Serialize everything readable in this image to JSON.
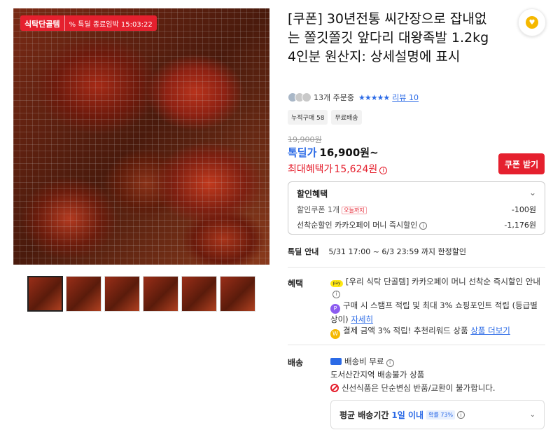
{
  "product": {
    "badge_label": "식탁단골템",
    "deal_badge": "% 특딜 종료임박 15:03:22",
    "title": "[쿠폰] 30년전통 씨간장으로 잡내없는 쫄깃쫄깃 앞다리 대왕족발 1.2kg 4인분 원산지: 상세설명에 표시",
    "buyer_count": "13개 주문중",
    "stars": "★★★★★",
    "review_link": "리뷰 10",
    "chips": [
      "누적구매 58",
      "무료배송"
    ],
    "original_price": "19,900원",
    "deal_label": "톡딜가",
    "deal_price": "16,900원~",
    "max_benefit_label": "최대혜택가",
    "max_benefit_price": "15,624원",
    "coupon_button": "쿠폰 받기"
  },
  "discount": {
    "header": "할인혜택",
    "rows": [
      {
        "label": "할인쿠폰 1개",
        "tag": "오늘까지",
        "value": "-100원"
      },
      {
        "label": "선착순할인 카카오페이 머니 즉시할인",
        "value": "-1,176원"
      }
    ]
  },
  "notice": {
    "label": "톡딜 안내",
    "text": "5/31 17:00 ~ 6/3 23:59 까지 한정할인"
  },
  "benefits": {
    "label": "혜택",
    "items": [
      "[우리 식탁 단골템] 카카오페이 머니 선착순 즉시할인 안내",
      "구매 시 스탬프 적립 및 최대 3% 쇼핑포인트 적립 (등급별 상이)",
      "자세히",
      "결제 금액 3% 적립! 추천리워드 상품",
      "상품 더보기"
    ]
  },
  "shipping": {
    "label": "배송",
    "fee": "배송비 무료",
    "region": "도서산간지역 배송불가 상품",
    "warning": "신선식품은 단순변심 반품/교환이 불가합니다.",
    "avg_label": "평균 배송기간",
    "avg_value": "1일 이내",
    "probability": "확률 73%"
  },
  "icons": [
    "heart-coin-icon",
    "star-icon",
    "kakaopay-icon",
    "point-icon",
    "coin-icon",
    "truck-icon",
    "ban-icon",
    "chevron-down-icon",
    "info-icon"
  ],
  "colors": {
    "accent_red": "#e5202e",
    "accent_blue": "#2b6ae6"
  }
}
